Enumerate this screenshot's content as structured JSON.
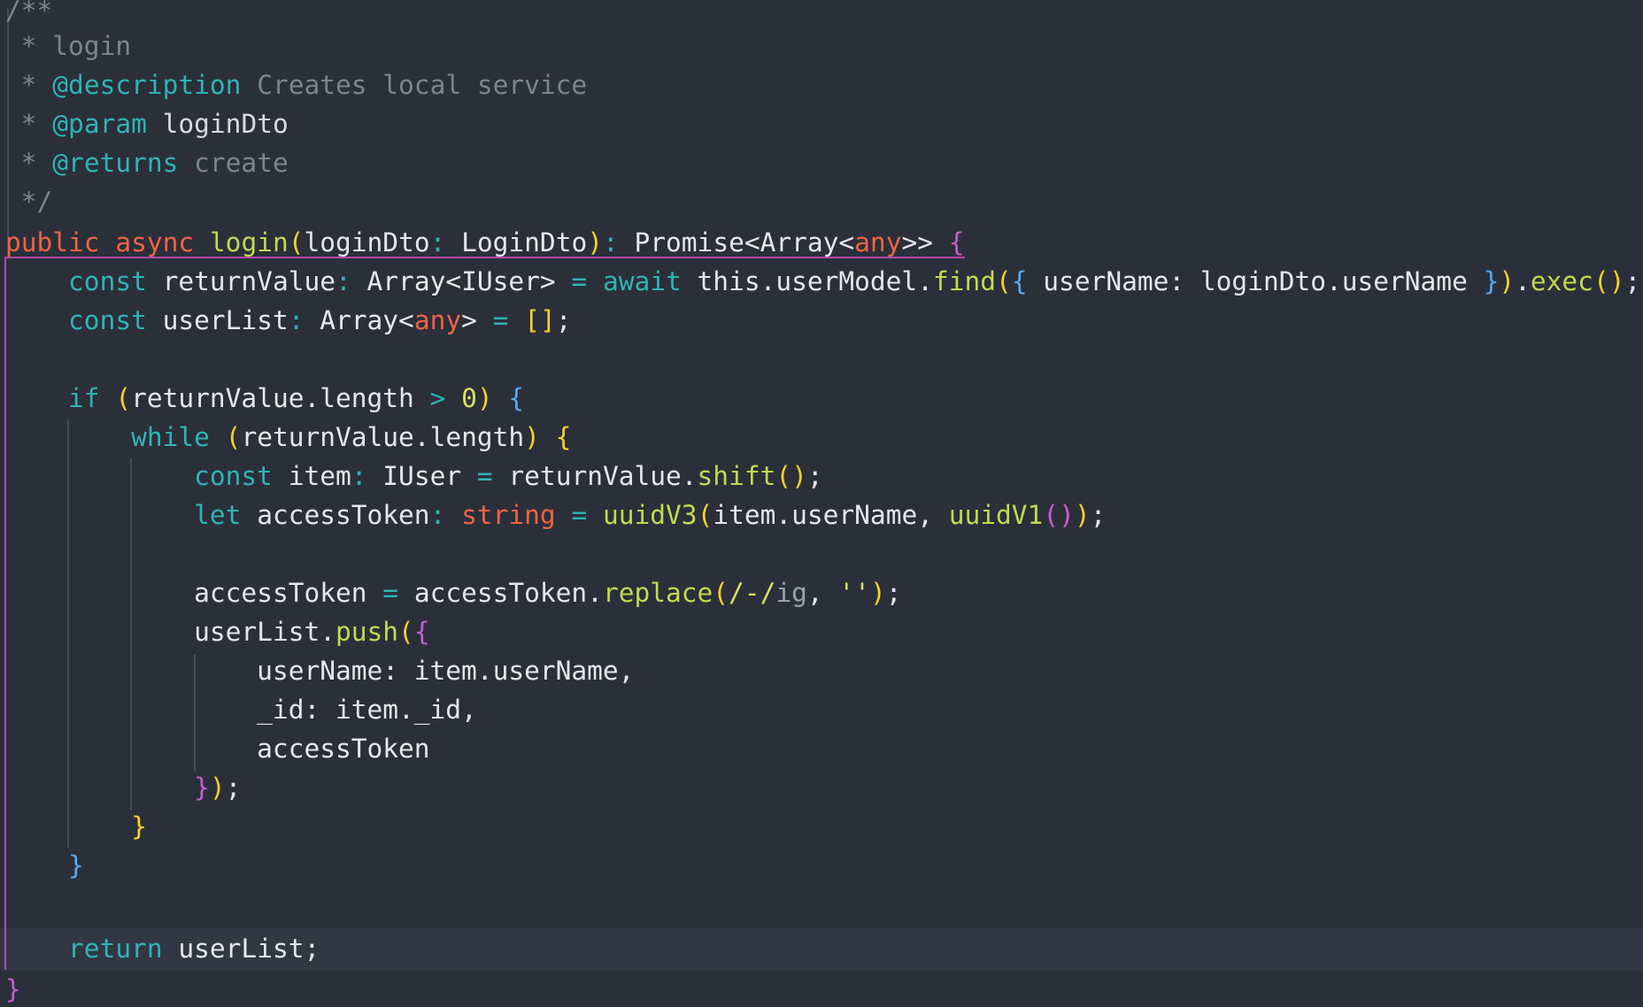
{
  "editor": {
    "language": "typescript",
    "theme": {
      "background": "#2b2f3a",
      "current_line": "#323744",
      "indent_guide": "#454b59",
      "bracket_match": "#b04bb0"
    },
    "lines": [
      [
        {
          "t": "/**",
          "c": "comment"
        }
      ],
      [
        {
          "t": " * login",
          "c": "comment"
        }
      ],
      [
        {
          "t": " * ",
          "c": "comment"
        },
        {
          "t": "@description",
          "c": "doctag"
        },
        {
          "t": " Creates local service",
          "c": "comment"
        }
      ],
      [
        {
          "t": " * ",
          "c": "comment"
        },
        {
          "t": "@param",
          "c": "doctag"
        },
        {
          "t": " loginDto",
          "c": "docname"
        }
      ],
      [
        {
          "t": " * ",
          "c": "comment"
        },
        {
          "t": "@returns",
          "c": "doctag"
        },
        {
          "t": " create",
          "c": "comment"
        }
      ],
      [
        {
          "t": " */",
          "c": "comment"
        }
      ],
      [
        {
          "t": "public",
          "c": "kw"
        },
        {
          "t": " ",
          "c": "txt"
        },
        {
          "t": "async",
          "c": "kw"
        },
        {
          "t": " ",
          "c": "txt"
        },
        {
          "t": "login",
          "c": "fn"
        },
        {
          "t": "(",
          "c": "p1"
        },
        {
          "t": "loginDto",
          "c": "txt"
        },
        {
          "t": ": ",
          "c": "op"
        },
        {
          "t": "LoginDto",
          "c": "type"
        },
        {
          "t": ")",
          "c": "p1"
        },
        {
          "t": ": ",
          "c": "op"
        },
        {
          "t": "Promise<Array<",
          "c": "type"
        },
        {
          "t": "any",
          "c": "kw"
        },
        {
          "t": ">>",
          "c": "type"
        },
        {
          "t": " ",
          "c": "txt"
        },
        {
          "t": "{",
          "c": "p2"
        }
      ],
      [
        {
          "t": "    ",
          "c": "txt"
        },
        {
          "t": "const",
          "c": "kw2"
        },
        {
          "t": " returnValue",
          "c": "txt"
        },
        {
          "t": ": ",
          "c": "op"
        },
        {
          "t": "Array<IUser>",
          "c": "type"
        },
        {
          "t": " = ",
          "c": "op"
        },
        {
          "t": "await",
          "c": "kw2"
        },
        {
          "t": " this.userModel.",
          "c": "txt"
        },
        {
          "t": "find",
          "c": "fn"
        },
        {
          "t": "(",
          "c": "p1"
        },
        {
          "t": "{",
          "c": "p3"
        },
        {
          "t": " userName: loginDto.userName ",
          "c": "txt"
        },
        {
          "t": "}",
          "c": "p3"
        },
        {
          "t": ")",
          "c": "p1"
        },
        {
          "t": ".",
          "c": "txt"
        },
        {
          "t": "exec",
          "c": "fn"
        },
        {
          "t": "()",
          "c": "p1"
        },
        {
          "t": ";",
          "c": "txt"
        }
      ],
      [
        {
          "t": "    ",
          "c": "txt"
        },
        {
          "t": "const",
          "c": "kw2"
        },
        {
          "t": " userList",
          "c": "txt"
        },
        {
          "t": ": ",
          "c": "op"
        },
        {
          "t": "Array<",
          "c": "type"
        },
        {
          "t": "any",
          "c": "kw"
        },
        {
          "t": ">",
          "c": "type"
        },
        {
          "t": " = ",
          "c": "op"
        },
        {
          "t": "[]",
          "c": "p1"
        },
        {
          "t": ";",
          "c": "txt"
        }
      ],
      [],
      [
        {
          "t": "    ",
          "c": "txt"
        },
        {
          "t": "if",
          "c": "kw2"
        },
        {
          "t": " ",
          "c": "txt"
        },
        {
          "t": "(",
          "c": "p1"
        },
        {
          "t": "returnValue.length",
          "c": "txt"
        },
        {
          "t": " > ",
          "c": "op"
        },
        {
          "t": "0",
          "c": "num"
        },
        {
          "t": ")",
          "c": "p1"
        },
        {
          "t": " ",
          "c": "txt"
        },
        {
          "t": "{",
          "c": "p3"
        }
      ],
      [
        {
          "t": "        ",
          "c": "txt"
        },
        {
          "t": "while",
          "c": "kw2"
        },
        {
          "t": " ",
          "c": "txt"
        },
        {
          "t": "(",
          "c": "p1"
        },
        {
          "t": "returnValue.length",
          "c": "txt"
        },
        {
          "t": ")",
          "c": "p1"
        },
        {
          "t": " ",
          "c": "txt"
        },
        {
          "t": "{",
          "c": "p1"
        }
      ],
      [
        {
          "t": "            ",
          "c": "txt"
        },
        {
          "t": "const",
          "c": "kw2"
        },
        {
          "t": " item",
          "c": "txt"
        },
        {
          "t": ": ",
          "c": "op"
        },
        {
          "t": "IUser",
          "c": "type"
        },
        {
          "t": " = ",
          "c": "op"
        },
        {
          "t": "returnValue.",
          "c": "txt"
        },
        {
          "t": "shift",
          "c": "fn"
        },
        {
          "t": "()",
          "c": "p1"
        },
        {
          "t": ";",
          "c": "txt"
        }
      ],
      [
        {
          "t": "            ",
          "c": "txt"
        },
        {
          "t": "let",
          "c": "kw2"
        },
        {
          "t": " accessToken",
          "c": "txt"
        },
        {
          "t": ": ",
          "c": "op"
        },
        {
          "t": "string",
          "c": "kw"
        },
        {
          "t": " = ",
          "c": "op"
        },
        {
          "t": "uuidV3",
          "c": "fn"
        },
        {
          "t": "(",
          "c": "p1"
        },
        {
          "t": "item.userName, ",
          "c": "txt"
        },
        {
          "t": "uuidV1",
          "c": "fn"
        },
        {
          "t": "()",
          "c": "p2"
        },
        {
          "t": ")",
          "c": "p1"
        },
        {
          "t": ";",
          "c": "txt"
        }
      ],
      [],
      [
        {
          "t": "            ",
          "c": "txt"
        },
        {
          "t": "accessToken",
          "c": "txt"
        },
        {
          "t": " = ",
          "c": "op"
        },
        {
          "t": "accessToken.",
          "c": "txt"
        },
        {
          "t": "replace",
          "c": "fn"
        },
        {
          "t": "(",
          "c": "p1"
        },
        {
          "t": "/-/",
          "c": "str"
        },
        {
          "t": "ig",
          "c": "rx"
        },
        {
          "t": ", ",
          "c": "txt"
        },
        {
          "t": "''",
          "c": "str"
        },
        {
          "t": ")",
          "c": "p1"
        },
        {
          "t": ";",
          "c": "txt"
        }
      ],
      [
        {
          "t": "            ",
          "c": "txt"
        },
        {
          "t": "userList.",
          "c": "txt"
        },
        {
          "t": "push",
          "c": "fn"
        },
        {
          "t": "(",
          "c": "p1"
        },
        {
          "t": "{",
          "c": "p2"
        }
      ],
      [
        {
          "t": "                userName: item.userName,",
          "c": "txt"
        }
      ],
      [
        {
          "t": "                _id: item._id,",
          "c": "txt"
        }
      ],
      [
        {
          "t": "                accessToken",
          "c": "txt"
        }
      ],
      [
        {
          "t": "            ",
          "c": "txt"
        },
        {
          "t": "}",
          "c": "p2"
        },
        {
          "t": ")",
          "c": "p1"
        },
        {
          "t": ";",
          "c": "txt"
        }
      ],
      [
        {
          "t": "        ",
          "c": "txt"
        },
        {
          "t": "}",
          "c": "p1"
        }
      ],
      [
        {
          "t": "    ",
          "c": "txt"
        },
        {
          "t": "}",
          "c": "p3"
        }
      ],
      [],
      [
        {
          "t": "    ",
          "c": "txt"
        },
        {
          "t": "return",
          "c": "kw2"
        },
        {
          "t": " userList;",
          "c": "txt"
        }
      ],
      [
        {
          "t": "}",
          "c": "p2"
        }
      ]
    ]
  }
}
